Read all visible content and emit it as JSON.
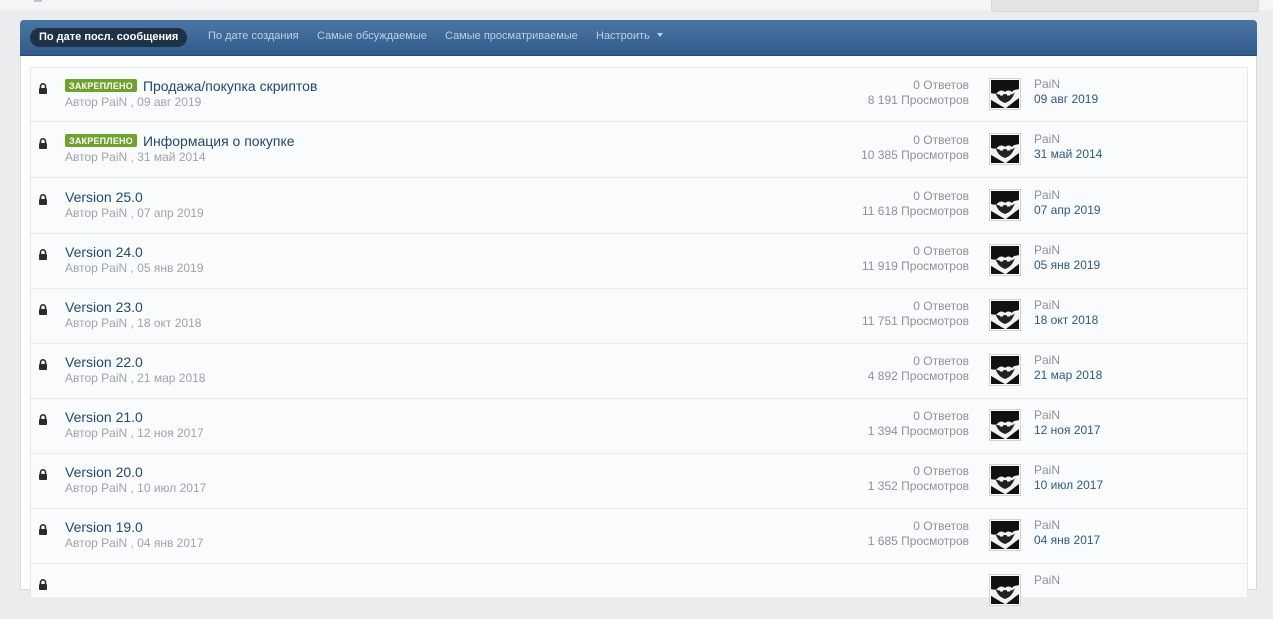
{
  "sort_bar": {
    "tabs": [
      {
        "label": "По дате посл. сообщения",
        "active": true
      },
      {
        "label": "По дате создания",
        "active": false
      },
      {
        "label": "Самые обсуждаемые",
        "active": false
      },
      {
        "label": "Самые просматриваемые",
        "active": false
      },
      {
        "label": "Настроить",
        "active": false,
        "dropdown": true
      }
    ]
  },
  "topics": [
    {
      "locked": true,
      "pinned": true,
      "pin_label": "ЗАКРЕПЛЕНО",
      "title": "Продажа/покупка скриптов",
      "meta": "Автор PaiN , 09 авг 2019",
      "replies": "0 Ответов",
      "views": "8 191 Просмотров",
      "last_user": "PaiN",
      "last_date": "09 авг 2019"
    },
    {
      "locked": true,
      "pinned": true,
      "pin_label": "ЗАКРЕПЛЕНО",
      "title": "Информация о покупке",
      "meta": "Автор PaiN , 31 май 2014",
      "replies": "0 Ответов",
      "views": "10 385 Просмотров",
      "last_user": "PaiN",
      "last_date": "31 май 2014"
    },
    {
      "locked": true,
      "pinned": false,
      "pin_label": "",
      "title": "Version 25.0",
      "meta": "Автор PaiN , 07 апр 2019",
      "replies": "0 Ответов",
      "views": "11 618 Просмотров",
      "last_user": "PaiN",
      "last_date": "07 апр 2019"
    },
    {
      "locked": true,
      "pinned": false,
      "pin_label": "",
      "title": "Version 24.0",
      "meta": "Автор PaiN , 05 янв 2019",
      "replies": "0 Ответов",
      "views": "11 919 Просмотров",
      "last_user": "PaiN",
      "last_date": "05 янв 2019"
    },
    {
      "locked": true,
      "pinned": false,
      "pin_label": "",
      "title": "Version 23.0",
      "meta": "Автор PaiN , 18 окт 2018",
      "replies": "0 Ответов",
      "views": "11 751 Просмотров",
      "last_user": "PaiN",
      "last_date": "18 окт 2018"
    },
    {
      "locked": true,
      "pinned": false,
      "pin_label": "",
      "title": "Version 22.0",
      "meta": "Автор PaiN , 21 мар 2018",
      "replies": "0 Ответов",
      "views": "4 892 Просмотров",
      "last_user": "PaiN",
      "last_date": "21 мар 2018"
    },
    {
      "locked": true,
      "pinned": false,
      "pin_label": "",
      "title": "Version 21.0",
      "meta": "Автор PaiN , 12 ноя 2017",
      "replies": "0 Ответов",
      "views": "1 394 Просмотров",
      "last_user": "PaiN",
      "last_date": "12 ноя 2017"
    },
    {
      "locked": true,
      "pinned": false,
      "pin_label": "",
      "title": "Version 20.0",
      "meta": "Автор PaiN , 10 июл 2017",
      "replies": "0 Ответов",
      "views": "1 352 Просмотров",
      "last_user": "PaiN",
      "last_date": "10 июл 2017"
    },
    {
      "locked": true,
      "pinned": false,
      "pin_label": "",
      "title": "Version 19.0",
      "meta": "Автор PaiN , 04 янв 2017",
      "replies": "0 Ответов",
      "views": "1 685 Просмотров",
      "last_user": "PaiN",
      "last_date": "04 янв 2017"
    },
    {
      "locked": true,
      "pinned": false,
      "pin_label": "",
      "title": "",
      "meta": "",
      "replies": "",
      "views": "",
      "last_user": "PaiN",
      "last_date": ""
    }
  ],
  "icons": {
    "lock": "lock-icon",
    "avatar": "user-avatar",
    "caret": "chevron-down-icon"
  },
  "colors": {
    "bar_top": "#4a76a5",
    "bar_bottom": "#305a89",
    "active_tab": "#1f3147",
    "pin_badge": "#6ea32b",
    "link": "#1e4a73",
    "date_link": "#2d5a86"
  }
}
